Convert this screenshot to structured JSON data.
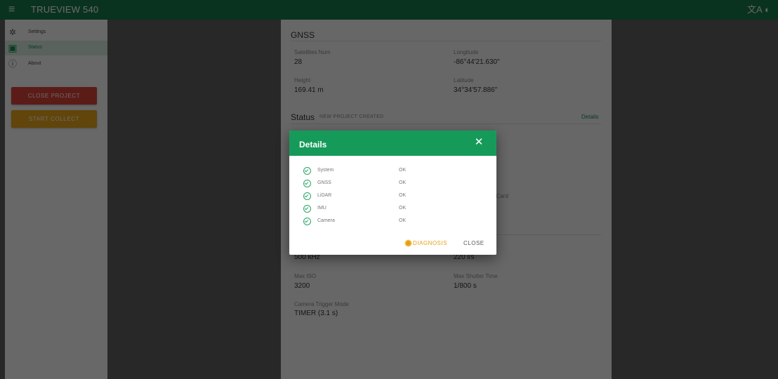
{
  "topbar": {
    "menu_icon": "menu-icon",
    "title": "TRUEVIEW 540",
    "translate_icon": "translate-icon",
    "theme_icon": "theme-icon",
    "menu_glyph": "≡",
    "translate_glyph": "文A",
    "theme_glyph": "◐",
    "color": "#18794a"
  },
  "sidebar": {
    "items": [
      {
        "label": "Settings",
        "icon": "gear-icon",
        "glyph": "✲"
      },
      {
        "label": "Status",
        "icon": "monitor-icon",
        "glyph": "▣",
        "active": true
      },
      {
        "label": "About",
        "icon": "info-icon",
        "glyph": "ⓘ"
      }
    ],
    "close_project": "CLOSE PROJECT",
    "start_collect": "START COLLECT",
    "close_color": "#d8433a",
    "collect_color": "#e6a51a"
  },
  "gnss": {
    "title": "GNSS",
    "satellites_label": "Satellites Num",
    "satellites_value": "28",
    "longitude_label": "Longitude",
    "longitude_value": "-86°44'21.630\"",
    "height_label": "Height",
    "height_value": "169.41 m",
    "latitude_label": "Latitude",
    "latitude_value": "34°34'57.886\""
  },
  "status": {
    "title": "Status",
    "subtitle": "NEW PROJECT CREATED",
    "details_link": "Details",
    "storage_partial": "age Card"
  },
  "lidar": {
    "freq_value": "500 kHz",
    "speed_value": "220 l/s"
  },
  "camera": {
    "max_iso_label": "Max ISO",
    "max_iso_value": "3200",
    "max_shutter_label": "Max Shutter Time",
    "max_shutter_value": "1/800 s",
    "trigger_label": "Camera Trigger Mode",
    "trigger_value": "TIMER (3.1 s)"
  },
  "dialog": {
    "title": "Details",
    "close_glyph": "✕",
    "rows": [
      {
        "name": "System",
        "status": "OK"
      },
      {
        "name": "GNSS",
        "status": "OK"
      },
      {
        "name": "LiDAR",
        "status": "OK"
      },
      {
        "name": "IMU",
        "status": "OK"
      },
      {
        "name": "Camera",
        "status": "OK"
      }
    ],
    "diagnosis_label": "DIAGNOSIS",
    "close_label": "CLOSE",
    "header_color": "#169a5a",
    "ok_color": "#2aa666",
    "diagnosis_color": "#e6a016"
  }
}
